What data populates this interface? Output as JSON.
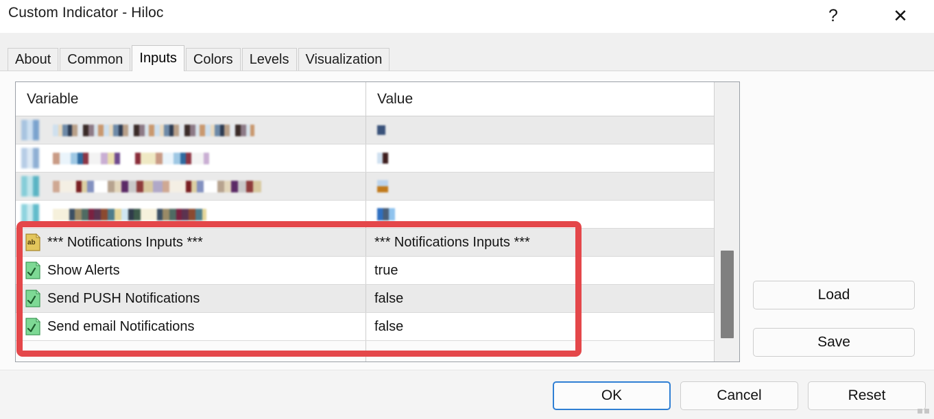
{
  "window": {
    "title": "Custom Indicator - Hiloc",
    "help_label": "?",
    "close_label": "✕"
  },
  "tabs": [
    {
      "label": "About",
      "selected": false
    },
    {
      "label": "Common",
      "selected": false
    },
    {
      "label": "Inputs",
      "selected": true
    },
    {
      "label": "Colors",
      "selected": false
    },
    {
      "label": "Levels",
      "selected": false
    },
    {
      "label": "Visualization",
      "selected": false
    }
  ],
  "table": {
    "columns": [
      "Variable",
      "Value"
    ],
    "redacted_rows": [
      {
        "variable": "",
        "value": "",
        "redacted": true
      },
      {
        "variable": "",
        "value": "",
        "redacted": true
      },
      {
        "variable": "",
        "value": "",
        "redacted": true
      },
      {
        "variable": "",
        "value": "",
        "redacted": true
      }
    ],
    "rows": [
      {
        "icon": "string-type-icon",
        "variable": "*** Notifications Inputs ***",
        "value": "*** Notifications Inputs ***"
      },
      {
        "icon": "bool-type-icon",
        "variable": "Show Alerts",
        "value": "true"
      },
      {
        "icon": "bool-type-icon",
        "variable": "Send PUSH Notifications",
        "value": "false"
      },
      {
        "icon": "bool-type-icon",
        "variable": "Send email Notifications",
        "value": "false"
      }
    ]
  },
  "side_buttons": {
    "load": "Load",
    "save": "Save"
  },
  "footer_buttons": {
    "ok": "OK",
    "cancel": "Cancel",
    "reset": "Reset"
  },
  "colors": {
    "highlight": "#e4474a",
    "focus_border": "#2f7fd4",
    "row_alt": "#eaeaea",
    "tabstrip": "#f0f0f0",
    "scrollbar_thumb": "#808080"
  }
}
